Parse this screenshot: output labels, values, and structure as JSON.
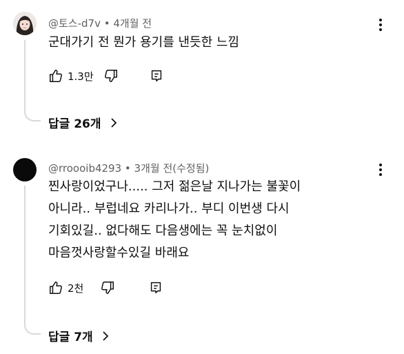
{
  "comments": [
    {
      "author": "@토스-d7v",
      "time": "4개월 전",
      "text": "군대가기 전 뭔가 용기를 낸듯한 느낌",
      "likes": "1.3만",
      "replies_label": "답글 26개"
    },
    {
      "author": "@rroooib4293",
      "time": "3개월 전(수정됨)",
      "text_lines": [
        "찐사랑이었구나..... 그저 젊은날 지나가는 불꽃이",
        "아니라.. 부럽네요 카리나가.. 부디 이번생 다시",
        "기회있길.. 없다해도 다음생에는 꼭 눈치없이",
        "마음껏사랑할수있길 바래요"
      ],
      "likes": "2천",
      "replies_label": "답글 7개"
    }
  ],
  "separator": " • ",
  "icons": {
    "like": "thumb-up-icon",
    "dislike": "thumb-down-icon",
    "reply": "reply-icon",
    "more": "more-vert-icon",
    "chevron": "chevron-right-icon"
  },
  "colors": {
    "meta": "#606060",
    "text": "#0f0f0f",
    "thread_line": "#d9d9d9"
  }
}
